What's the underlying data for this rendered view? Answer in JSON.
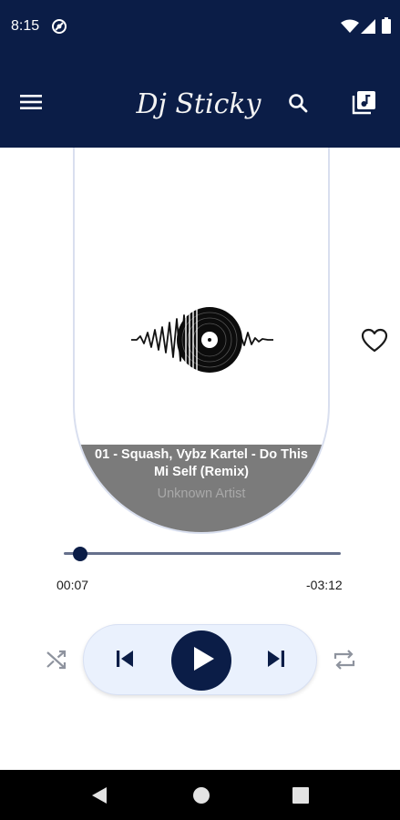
{
  "status_bar": {
    "time": "8:15",
    "icons": [
      "vpn-icon",
      "wifi-icon",
      "signal-icon",
      "battery-icon"
    ]
  },
  "app_bar": {
    "title": "Dj Sticky",
    "menu_icon": "menu-icon",
    "search_icon": "search-icon",
    "library_icon": "music-library-icon"
  },
  "now_playing": {
    "title": "01 - Squash, Vybz Kartel - Do This Mi Self (Remix)",
    "artist": "Unknown Artist",
    "artwork_icon": "vinyl-soundwave-icon",
    "favorite_icon": "heart-outline-icon"
  },
  "progress": {
    "elapsed": "00:07",
    "remaining": "-03:12",
    "fraction": 0.035
  },
  "controls": {
    "shuffle_icon": "shuffle-icon",
    "previous_icon": "skip-previous-icon",
    "play_icon": "play-icon",
    "next_icon": "skip-next-icon",
    "repeat_icon": "repeat-icon"
  },
  "colors": {
    "primary": "#0b1d47",
    "controls_background": "#eaf1fd",
    "info_band": "#7b7b7b",
    "artist_text": "#a9a9a9"
  },
  "nav_bar": {
    "icons": [
      "back-icon",
      "home-icon",
      "recents-icon"
    ]
  }
}
